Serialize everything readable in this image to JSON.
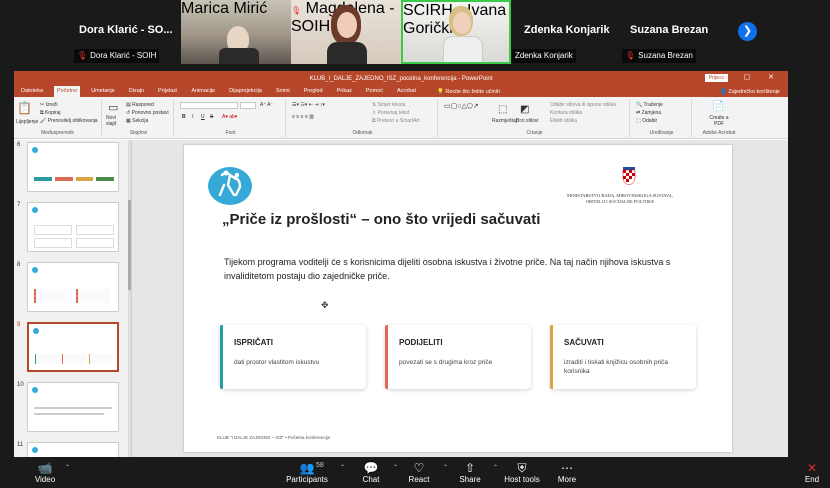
{
  "participants": [
    {
      "big_name": "Dora Klarić - SO...",
      "label": "Dora Klarić - SOIH",
      "muted": true
    },
    {
      "label": "Marica Mirić",
      "muted": false
    },
    {
      "label": "Magdalena - SOIH",
      "muted": true
    },
    {
      "label": "SCIRH - Ivana Gorički",
      "muted": false
    },
    {
      "big_name": "Zdenka Konjarik",
      "label": "Zdenka Konjarik",
      "muted": false
    },
    {
      "big_name": "Suzana Brezan",
      "label": "Suzana Brezan",
      "muted": true
    }
  ],
  "next_icon": "chevron-right-icon",
  "ppt": {
    "window_title": "KLUB_I_DALJE_ZAJEDNO_ISZ_pocetna_konferencija - PowerPoint",
    "signin": "Prijava",
    "win_controls": "— ▢ ✕",
    "tabs": [
      "Datoteka",
      "Početno",
      "Umetanje",
      "Dizajn",
      "Prijelazi",
      "Animacije",
      "Dijaprojekcija",
      "Snimi",
      "Pregled",
      "Prikaz",
      "Pomoć",
      "Acrobat"
    ],
    "active_tab": 1,
    "tell_me": "Recite što želite učiniti",
    "share": "Zajedničko korištenje",
    "ribbon": {
      "clipboard": {
        "paste": "Lijepljenje",
        "cut": "Izreži",
        "copy": "Kopiraj",
        "painter": "Prenositelj oblikovanja",
        "label": "Međuspremnik"
      },
      "slides": {
        "new": "Novi slajd",
        "layout": "Raspored",
        "reset": "Ponovno postavi",
        "section": "Sekcija",
        "label": "Slajdovi"
      },
      "font": {
        "label": "Font",
        "bold": "B",
        "italic": "I",
        "underline": "U",
        "strike": "S"
      },
      "paragraph": {
        "label": "Odlomak",
        "direction": "Smjer teksta",
        "align": "Poravnaj tekst",
        "smartart": "Pretvori u SmartArt"
      },
      "drawing": {
        "label": "Crtanje",
        "arrange": "Razmještaj",
        "quick": "Brzi stilovi",
        "fill": "Odabir stilova ili ispune oblika",
        "outline": "Kontura oblika",
        "effects": "Efekti oblika"
      },
      "editing": {
        "label": "Uređivanje",
        "find": "Traženje",
        "replace": "Zamjena",
        "select": "Odabir"
      },
      "acrobat": {
        "label": "Adobe Acrobat",
        "create": "Create a PDF"
      }
    },
    "thumbnails": [
      {
        "num": "6",
        "selected": false
      },
      {
        "num": "7",
        "selected": false
      },
      {
        "num": "8",
        "selected": false
      },
      {
        "num": "9",
        "selected": true
      },
      {
        "num": "10",
        "selected": false
      },
      {
        "num": "11",
        "selected": false
      }
    ],
    "slide": {
      "ministry": "MINISTARSTVO RADA, MIROVINSKOGA SUSTAVA, OBITELJI I SOCIJALNE POLITIKE",
      "title": "„Priče iz prošlosti“ – ono što vrijedi sačuvati",
      "body": "Tijekom programa voditelji će s korisnicima dijeliti osobna iskustva i životne priče. Na taj način njihova iskustva s invaliditetom postaju dio zajedničke priče.",
      "cards": [
        {
          "title": "ISPRIČATI",
          "text": "dati prostor vlastitom iskustvu",
          "color": "#2a9d9a"
        },
        {
          "title": "PODIJELITI",
          "text": "povezati se s drugima kroz priče",
          "color": "#e06a5a"
        },
        {
          "title": "SAČUVATI",
          "text": "izraditi i tiskati knjižicu osobnih priča korisnika",
          "color": "#d9a441"
        }
      ],
      "footer": "KLUB \"I DALJE ZAJEDNO – ISZ\"  •  Početna konferencija"
    }
  },
  "toolbar": {
    "video": "Video",
    "participants": "Participants",
    "participants_count": "58",
    "chat": "Chat",
    "react": "React",
    "share": "Share",
    "host_tools": "Host tools",
    "more": "More",
    "end": "End"
  },
  "colors": {
    "ppt_accent": "#b7472a",
    "zoom_blue": "#0e71eb",
    "end_red": "#e02828"
  }
}
